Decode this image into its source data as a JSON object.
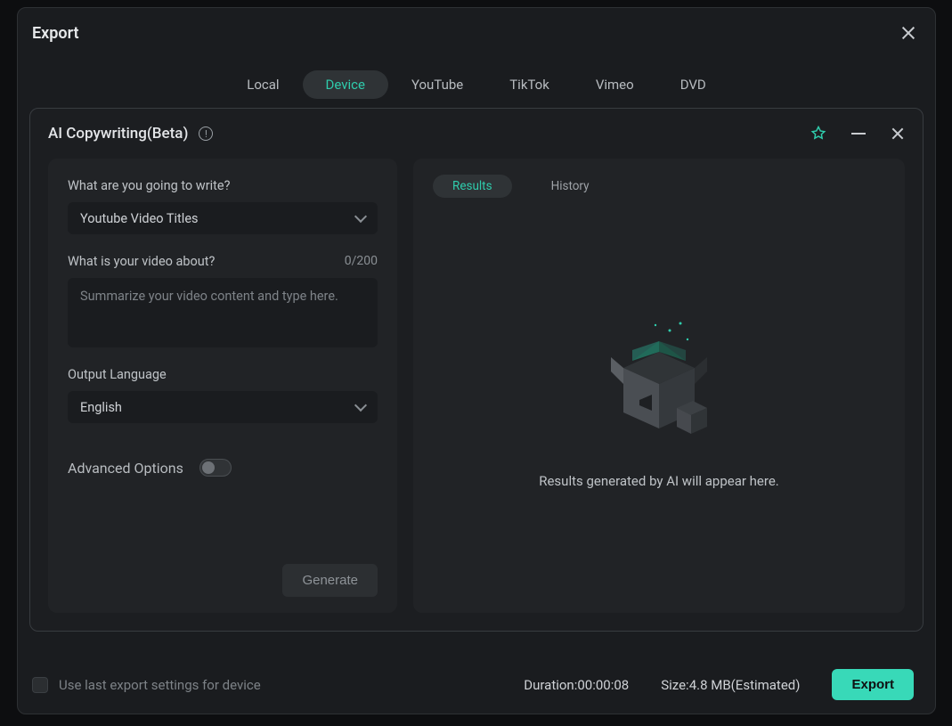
{
  "modal": {
    "title": "Export",
    "tabs": [
      "Local",
      "Device",
      "YouTube",
      "TikTok",
      "Vimeo",
      "DVD"
    ],
    "active_tab": "Device"
  },
  "ai": {
    "title": "AI Copywriting(Beta)",
    "prompt_label": "What are you going to write?",
    "prompt_type": "Youtube Video Titles",
    "about_label": "What is your video about?",
    "about_counter": "0/200",
    "about_placeholder": "Summarize your video content and type here.",
    "lang_label": "Output Language",
    "lang_value": "English",
    "advanced_label": "Advanced Options",
    "generate_label": "Generate",
    "results_tab": "Results",
    "history_tab": "History",
    "empty_text": "Results generated by AI will appear here."
  },
  "footer": {
    "checkbox_label": "Use last export settings for device",
    "duration_label": "Duration:",
    "duration_value": "00:00:08",
    "size_label": "Size:",
    "size_value": "4.8 MB(Estimated)",
    "export_label": "Export"
  }
}
